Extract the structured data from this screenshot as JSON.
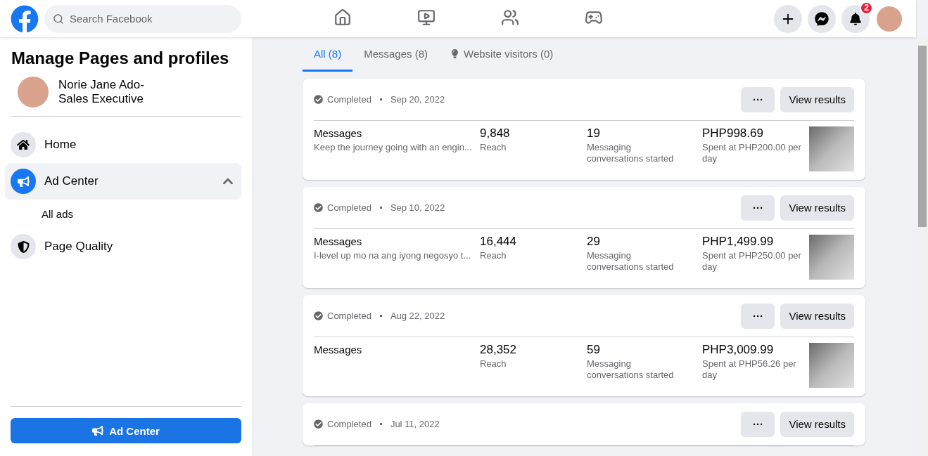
{
  "topbar": {
    "search": {
      "placeholder": "Search Facebook"
    },
    "nav": [
      {
        "kind": "home",
        "selected": false
      },
      {
        "kind": "video",
        "selected": false
      },
      {
        "kind": "groups",
        "selected": false
      },
      {
        "kind": "gaming",
        "selected": false
      }
    ],
    "notifications": {
      "count": "2"
    }
  },
  "sidebar": {
    "title": "Manage Pages and profiles",
    "profile": {
      "name": "Norie Jane Ado-",
      "role": "Sales Executive"
    },
    "items": [
      {
        "kind": "home",
        "label": "Home",
        "selected": false
      },
      {
        "kind": "ads",
        "label": "Ad Center",
        "selected": true,
        "expanded": true,
        "children": [
          {
            "label": "All ads",
            "selected": false
          }
        ]
      },
      {
        "kind": "quality",
        "label": "Page Quality",
        "selected": false
      }
    ],
    "button": "Ad Center"
  },
  "tabs": [
    {
      "label": "All (8)",
      "selected": true,
      "kind": "plain"
    },
    {
      "label": "Messages (8)",
      "selected": false,
      "kind": "plain"
    },
    {
      "label": "Website visitors (0)",
      "selected": false,
      "kind": "bulb"
    }
  ],
  "ads": [
    {
      "status": "Completed",
      "date": "Sep 20, 2022",
      "objective": "Messages",
      "description": "Keep the journey going with an engin...",
      "reach": "9,848",
      "reach_label": "Reach",
      "results": "19",
      "results_label": "Messaging conversations started",
      "spent": "PHP998.69",
      "spent_label": "Spent at PHP200.00 per day",
      "more": "···",
      "action": "View results"
    },
    {
      "status": "Completed",
      "date": "Sep 10, 2022",
      "objective": "Messages",
      "description": "I-level up mo na ang iyong negosyo t...",
      "reach": "16,444",
      "reach_label": "Reach",
      "results": "29",
      "results_label": "Messaging conversations started",
      "spent": "PHP1,499.99",
      "spent_label": "Spent at PHP250.00 per day",
      "more": "···",
      "action": "View results"
    },
    {
      "status": "Completed",
      "date": "Aug 22, 2022",
      "objective": "Messages",
      "reach": "28,352",
      "reach_label": "Reach",
      "results": "59",
      "results_label": "Messaging conversations started",
      "spent": "PHP3,009.99",
      "spent_label": "Spent at PHP56.26 per day",
      "more": "···",
      "action": "View results"
    },
    {
      "status": "Completed",
      "date": "Jul 11, 2022",
      "more": "···",
      "action": "View results"
    }
  ]
}
